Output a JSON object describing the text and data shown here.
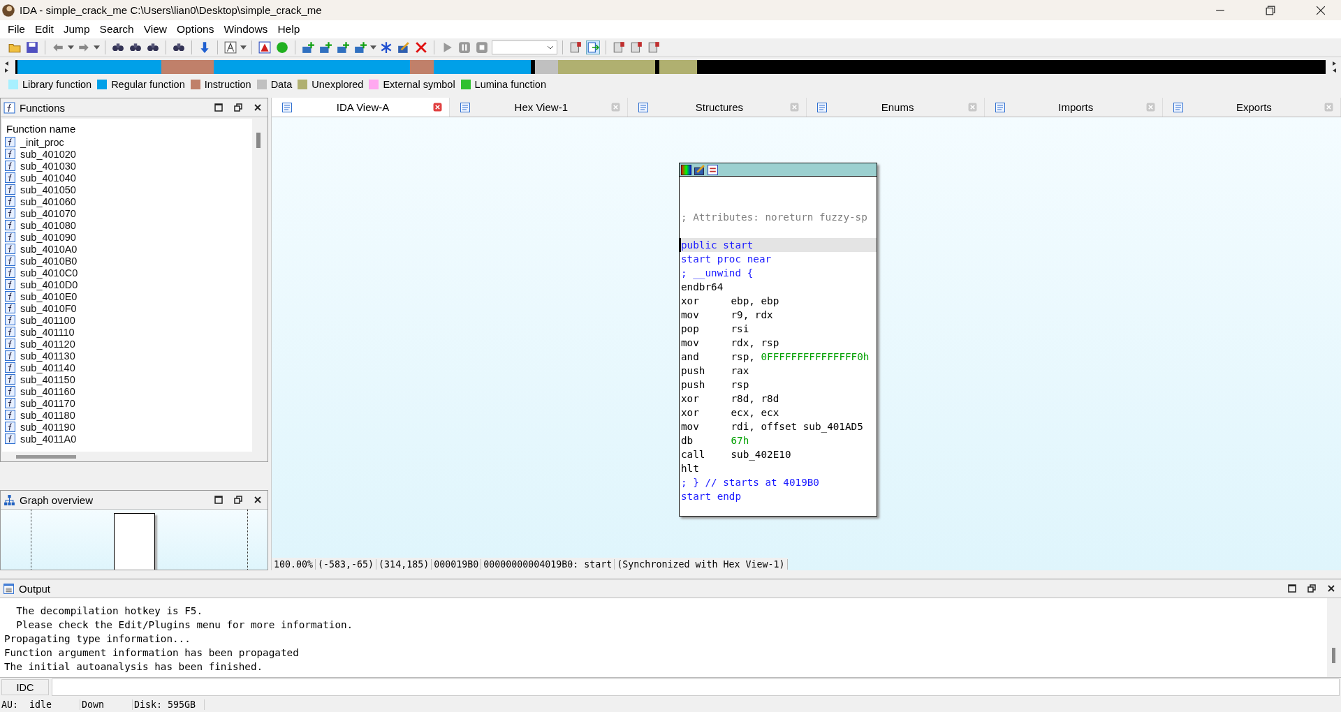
{
  "window": {
    "title": "IDA - simple_crack_me C:\\Users\\lian0\\Desktop\\simple_crack_me"
  },
  "menu": [
    "File",
    "Edit",
    "Jump",
    "Search",
    "View",
    "Options",
    "Windows",
    "Help"
  ],
  "legend": [
    {
      "label": "Library function",
      "color": "#a8f0ff"
    },
    {
      "label": "Regular function",
      "color": "#00a0e8"
    },
    {
      "label": "Instruction",
      "color": "#c0806a"
    },
    {
      "label": "Data",
      "color": "#c0c0c0"
    },
    {
      "label": "Unexplored",
      "color": "#b0b070"
    },
    {
      "label": "External symbol",
      "color": "#ffa8f0"
    },
    {
      "label": "Lumina function",
      "color": "#30c030"
    }
  ],
  "functions_panel": {
    "title": "Functions",
    "column": "Function name",
    "items": [
      "_init_proc",
      "sub_401020",
      "sub_401030",
      "sub_401040",
      "sub_401050",
      "sub_401060",
      "sub_401070",
      "sub_401080",
      "sub_401090",
      "sub_4010A0",
      "sub_4010B0",
      "sub_4010C0",
      "sub_4010D0",
      "sub_4010E0",
      "sub_4010F0",
      "sub_401100",
      "sub_401110",
      "sub_401120",
      "sub_401130",
      "sub_401140",
      "sub_401150",
      "sub_401160",
      "sub_401170",
      "sub_401180",
      "sub_401190",
      "sub_4011A0"
    ]
  },
  "graph_overview": {
    "title": "Graph overview"
  },
  "tabs": [
    {
      "label": "IDA View-A",
      "selected": true
    },
    {
      "label": "Hex View-1",
      "selected": false
    },
    {
      "label": "Structures",
      "selected": false
    },
    {
      "label": "Enums",
      "selected": false
    },
    {
      "label": "Imports",
      "selected": false
    },
    {
      "label": "Exports",
      "selected": false
    }
  ],
  "graph_node": {
    "lines": [
      {
        "kind": "comment",
        "text": "; Attributes: noreturn fuzzy-sp",
        "selected": false
      },
      {
        "kind": "blank",
        "selected": false
      },
      {
        "kind": "label",
        "text": "public start",
        "selected": true
      },
      {
        "kind": "label",
        "text": "start proc near",
        "selected": false
      },
      {
        "kind": "label",
        "text": "; __unwind {",
        "selected": false
      },
      {
        "kind": "insn",
        "mnemonic": "endbr64",
        "selected": false
      },
      {
        "kind": "insn",
        "mnemonic": "xor",
        "operands": [
          {
            "text": "ebp, ebp",
            "kind": "reg"
          }
        ],
        "selected": false
      },
      {
        "kind": "insn",
        "mnemonic": "mov",
        "operands": [
          {
            "text": "r9, rdx",
            "kind": "reg"
          }
        ],
        "selected": false
      },
      {
        "kind": "insn",
        "mnemonic": "pop",
        "operands": [
          {
            "text": "rsi",
            "kind": "reg"
          }
        ],
        "selected": false
      },
      {
        "kind": "insn",
        "mnemonic": "mov",
        "operands": [
          {
            "text": "rdx, rsp",
            "kind": "reg"
          }
        ],
        "selected": false
      },
      {
        "kind": "insn",
        "mnemonic": "and",
        "operands": [
          {
            "text": "rsp, ",
            "kind": "reg"
          },
          {
            "text": "0FFFFFFFFFFFFFFF0h",
            "kind": "imm"
          }
        ],
        "selected": false
      },
      {
        "kind": "insn",
        "mnemonic": "push",
        "operands": [
          {
            "text": "rax",
            "kind": "reg"
          }
        ],
        "selected": false
      },
      {
        "kind": "insn",
        "mnemonic": "push",
        "operands": [
          {
            "text": "rsp",
            "kind": "reg"
          }
        ],
        "selected": false
      },
      {
        "kind": "insn",
        "mnemonic": "xor",
        "operands": [
          {
            "text": "r8d, r8d",
            "kind": "reg"
          }
        ],
        "selected": false
      },
      {
        "kind": "insn",
        "mnemonic": "xor",
        "operands": [
          {
            "text": "ecx, ecx",
            "kind": "reg"
          }
        ],
        "selected": false
      },
      {
        "kind": "insn",
        "mnemonic": "mov",
        "operands": [
          {
            "text": "rdi, offset sub_401AD5",
            "kind": "reg"
          }
        ],
        "selected": false
      },
      {
        "kind": "insn",
        "mnemonic": "db",
        "operands": [
          {
            "text": "67h",
            "kind": "imm"
          }
        ],
        "selected": false
      },
      {
        "kind": "insn",
        "mnemonic": "call",
        "operands": [
          {
            "text": "sub_402E10",
            "kind": "reg"
          }
        ],
        "selected": false
      },
      {
        "kind": "insn",
        "mnemonic": "hlt",
        "selected": false
      },
      {
        "kind": "label",
        "text": "; } // starts at 4019B0",
        "selected": false
      },
      {
        "kind": "label",
        "text": "start endp",
        "selected": false
      }
    ]
  },
  "view_status": [
    "100.00%",
    "(-583,-65)",
    "(314,185)",
    "000019B0",
    "00000000004019B0: start",
    "(Synchronized with Hex View-1)"
  ],
  "output": {
    "title": "Output",
    "lines": [
      "  The decompilation hotkey is F5.",
      "  Please check the Edit/Plugins menu for more information.",
      "Propagating type information...",
      "Function argument information has been propagated",
      "The initial autoanalysis has been finished."
    ]
  },
  "command": {
    "language": "IDC"
  },
  "status_bar": [
    "AU:  idle",
    "Down",
    "Disk: 595GB"
  ]
}
